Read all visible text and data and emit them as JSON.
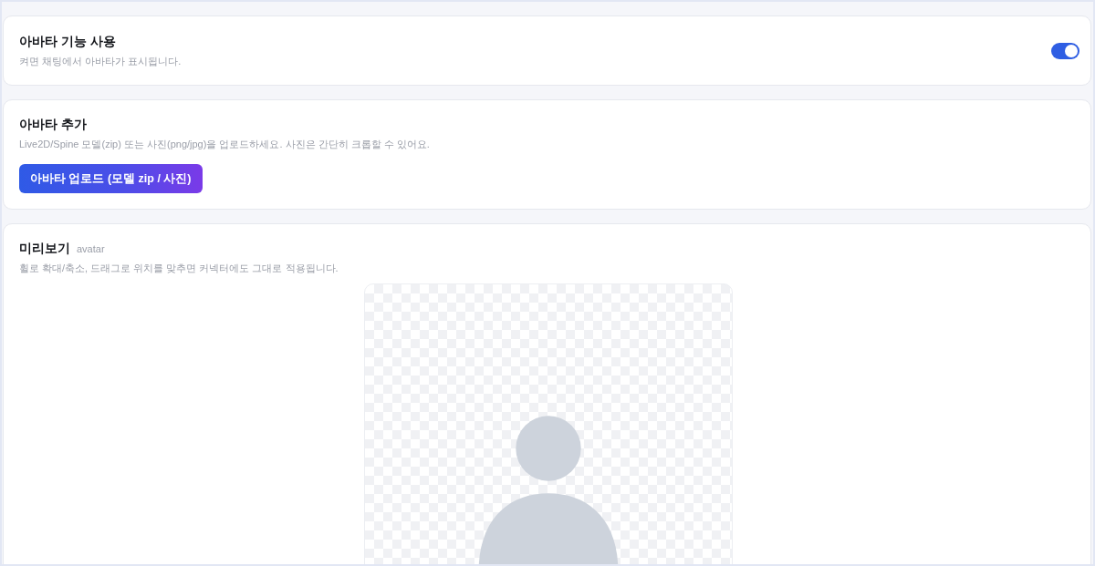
{
  "avatar_feature": {
    "title": "아바타 기능 사용",
    "description": "켜면 채팅에서 아바타가 표시됩니다.",
    "on": true
  },
  "add_avatar": {
    "title": "아바타 추가",
    "description": "Live2D/Spine 모델(zip) 또는 사진(png/jpg)을 업로드하세요. 사진은 간단히 크롭할 수 있어요.",
    "button": "아바타 업로드 (모델 zip / 사진)"
  },
  "preview": {
    "title": "미리보기",
    "tag": "avatar",
    "description": "휠로 확대/축소, 드래그로 위치를 맞추면 커넥터에도 그대로 적용됩니다."
  }
}
